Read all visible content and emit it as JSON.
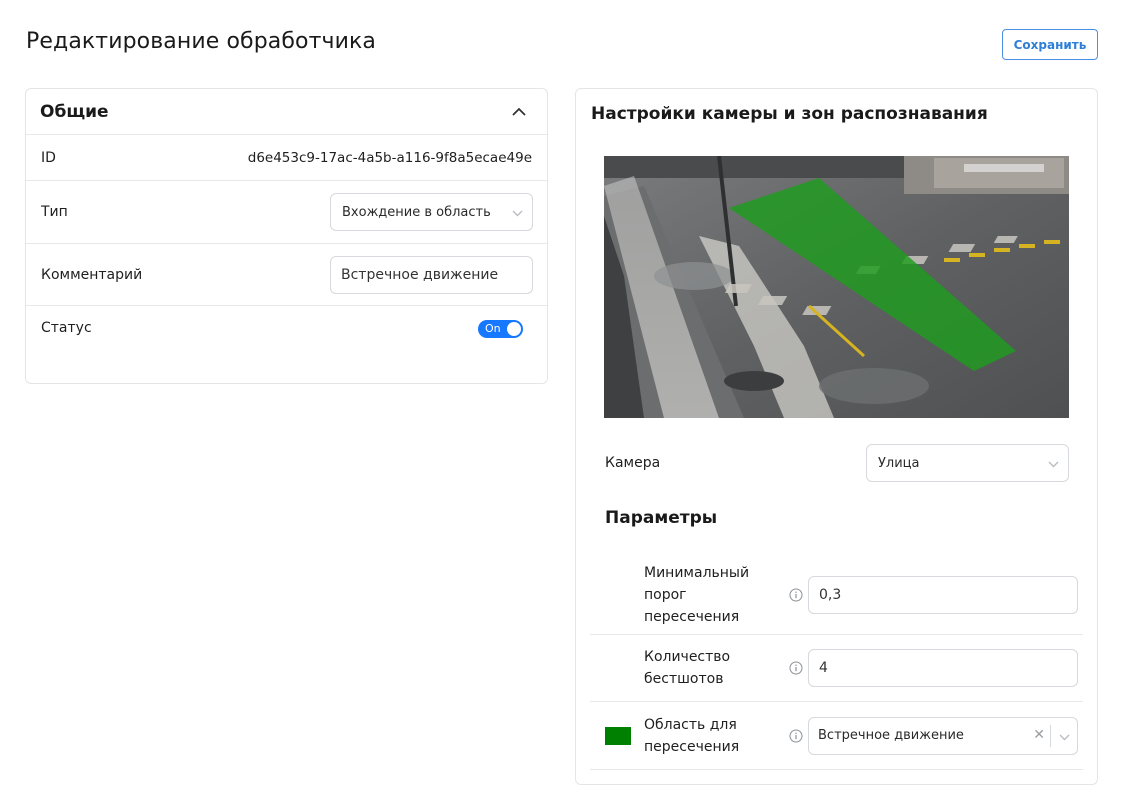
{
  "page": {
    "title": "Редактирование обработчика",
    "save_label": "Сохранить"
  },
  "general": {
    "title": "Общие",
    "id_label": "ID",
    "id_value": "d6e453c9-17ac-4a5b-a116-9f8a5ecae49e",
    "type_label": "Тип",
    "type_value": "Вхождение в область",
    "comment_label": "Комментарий",
    "comment_value": "Встречное движение",
    "status_label": "Статус",
    "status_toggle_text": "On"
  },
  "camera_settings": {
    "title": "Настройки камеры и зон распознавания",
    "camera_label": "Камера",
    "camera_value": "Улица",
    "zone_color": "#008000",
    "params_title": "Параметры",
    "params": [
      {
        "label": "Минимальный порог пересечения",
        "value": "0,3"
      },
      {
        "label": "Количество бестшотов",
        "value": "4"
      },
      {
        "label": "Область для пересечения",
        "value": "Встречное движение"
      }
    ]
  },
  "colors": {
    "accent": "#1677ff",
    "border": "#e3e5e8",
    "zone_green": "#008000"
  }
}
